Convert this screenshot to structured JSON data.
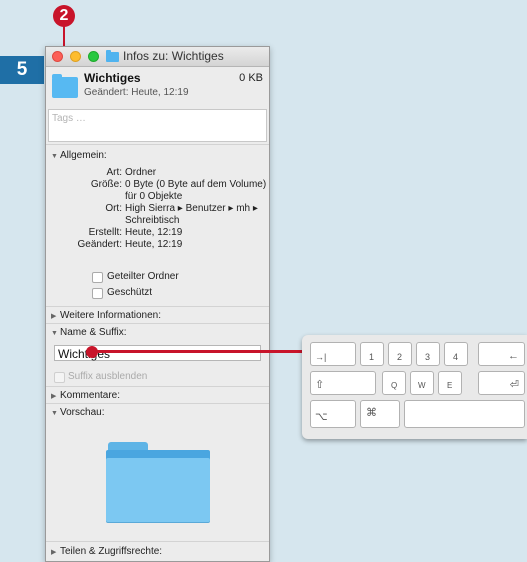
{
  "callouts": {
    "step": "5",
    "marker": "2"
  },
  "window": {
    "title": "Infos zu: Wichtiges",
    "name": "Wichtiges",
    "size": "0 KB",
    "modified_line": "Geändert: Heute, 12:19",
    "tags_placeholder": "Tags …"
  },
  "general": {
    "header": "Allgemein:",
    "rows": [
      {
        "key": "Art:",
        "value": "Ordner"
      },
      {
        "key": "Größe:",
        "value": "0 Byte (0 Byte auf dem Volume)"
      },
      {
        "key": "",
        "value": "für 0 Objekte"
      },
      {
        "key": "Ort:",
        "value": "High Sierra ▸ Benutzer ▸ mh ▸"
      },
      {
        "key": "",
        "value": "Schreibtisch"
      },
      {
        "key": "Erstellt:",
        "value": "Heute, 12:19"
      },
      {
        "key": "Geändert:",
        "value": "Heute, 12:19"
      }
    ],
    "checkboxes": [
      "Geteilter Ordner",
      "Geschützt"
    ]
  },
  "sections": {
    "more_info": "Weitere Informationen:",
    "name_suffix": "Name & Suffix:",
    "name_value": "Wichtiges",
    "hide_suffix": "Suffix ausblenden",
    "comments": "Kommentare:",
    "preview": "Vorschau:",
    "sharing": "Teilen & Zugriffsrechte:"
  },
  "keyboard": {
    "row1": [
      "→|",
      "1",
      "2",
      "3",
      "4",
      "←"
    ],
    "row2": [
      "⇧",
      "Q",
      "W",
      "E",
      "⏎"
    ],
    "row3": [
      "⌥",
      "⌘",
      ""
    ]
  },
  "colors": {
    "accent": "#c8142a",
    "step_badge": "#1f6fa6",
    "folder": "#57b9f2"
  }
}
